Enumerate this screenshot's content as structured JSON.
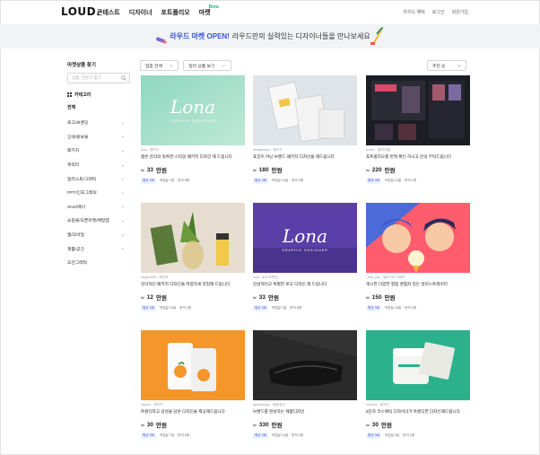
{
  "header": {
    "logo": "LOUD.",
    "nav": [
      {
        "label": "콘테스트"
      },
      {
        "label": "디자이너"
      },
      {
        "label": "포트폴리오"
      },
      {
        "label": "마켓",
        "badge": "Beta"
      }
    ],
    "util": [
      "라우드 혜택",
      "로그인",
      "회원가입"
    ]
  },
  "banner": {
    "highlight": "라우드 마켓 OPEN!",
    "text": "라우드만의 실력있는 디자이너들을 만나보세요"
  },
  "sidebar": {
    "title": "마켓상품 찾기",
    "search_placeholder": "상품, 전문가 찾기",
    "category_label": "카테고리",
    "all_label": "전체",
    "items": [
      {
        "label": "로고/브랜딩",
        "chevron": true
      },
      {
        "label": "인쇄/홍보물",
        "chevron": true
      },
      {
        "label": "패키지",
        "chevron": true
      },
      {
        "label": "캐릭터",
        "chevron": true
      },
      {
        "label": "일러스트/그래픽",
        "chevron": true
      },
      {
        "label": "PPT/인포그래픽",
        "chevron": true
      },
      {
        "label": "SNS/배너",
        "chevron": true
      },
      {
        "label": "쇼핑몰/오픈마켓/배달앱",
        "chevron": true
      },
      {
        "label": "웹/모바일",
        "chevron": true
      },
      {
        "label": "제품/공간",
        "chevron": true
      },
      {
        "label": "모션그래픽",
        "chevron": false
      }
    ]
  },
  "filters": {
    "category_select": "업종 전체",
    "type_select": "일러 상품 보기",
    "sort_select": "추천 순"
  },
  "cards": [
    {
      "meta": "lona · 패키지",
      "title": "젊은 감각의 독특한 스타일 패키지 디자인 해 드립니다",
      "price": "33",
      "unit": "만원",
      "tag1": "평균 3회",
      "tag2": "작업일 7일",
      "tag3": "문의 8명"
    },
    {
      "meta": "designstand · 패키지",
      "title": "포장이 아닌 브랜드 패키지 디자인을 해드립니다",
      "price": "180",
      "unit": "만원",
      "tag1": "평균 3회",
      "tag2": "작업일 14일",
      "tag3": "문의 3명"
    },
    {
      "meta": "kohee · 웹/모바일",
      "title": "포트폴리오를 반짝 확인 하시고 문의 부탁드립니다",
      "price": "220",
      "unit": "만원",
      "tag1": "평균 4회",
      "tag2": "작업일 14일",
      "tag3": "문의 1명"
    },
    {
      "meta": "seyjin0406 · 패키지",
      "title": "감각적인 패키지 디자인을 저렴하게 작업해 드립니다",
      "price": "12",
      "unit": "만원",
      "tag1": "평균 2회",
      "tag2": "작업일 10일",
      "tag3": "문의 0명"
    },
    {
      "meta": "lona · 로고/브랜딩",
      "title": "감성적이고 특별한 로고 디자인 해 드립니다",
      "price": "33",
      "unit": "만원",
      "tag1": "평균 3회",
      "tag2": "작업일 7일",
      "tag3": "문의 8명"
    },
    {
      "meta": "_ddo_yun · 일러스트/그래픽",
      "title": "섹시한 다양한 협업 경험자 있는 일러스트레이터",
      "price": "150",
      "unit": "만원",
      "tag1": "평균 3회",
      "tag2": "작업일 15일",
      "tag3": "문의 2명"
    },
    {
      "meta": "lleeceu · 패키지",
      "title": "트렌디하고 감성을 담은 디자인을 제공해드립니다",
      "price": "30",
      "unit": "만원",
      "tag1": "평균 3회",
      "tag2": "작업일 7일",
      "tag3": "문의 8명"
    },
    {
      "meta": "ammdesign · 제품/공간",
      "title": "브랜드를 완성하는 제품디자인",
      "price": "330",
      "unit": "만원",
      "tag1": "평균 3회",
      "tag2": "작업일 14일",
      "tag3": "문의 4명"
    },
    {
      "meta": "cosmeo · 패키지",
      "title": "5단차 코스메틱 디자이너가 트렌디한 디자인해드립니다",
      "price": "30",
      "unit": "만원",
      "tag1": "평균 3회",
      "tag2": "작업일 2일",
      "tag3": "문의 0명"
    }
  ],
  "thumbs": [
    {
      "name": "lona-package-thumb",
      "text": "Lona",
      "sub": "GRAPHIC DESIGNER",
      "bg1": "#8fd8c0",
      "bg2": "#bfe8d8"
    },
    {
      "name": "pouch-package-thumb",
      "bg1": "#dfe4e8"
    },
    {
      "name": "web-portfolio-thumb",
      "bg1": "#1c1c24"
    },
    {
      "name": "bottle-package-thumb",
      "bg1": "#e6ddd0"
    },
    {
      "name": "lona-logo-thumb",
      "text": "Lona",
      "sub": "GRAPHIC DESIGNER",
      "bg1": "#5a3fa8"
    },
    {
      "name": "illustration-thumb",
      "bg1": "#ff5d6e"
    },
    {
      "name": "orange-pouch-thumb",
      "bg1": "#f4962a"
    },
    {
      "name": "product-device-thumb",
      "bg1": "#2a2a2a"
    },
    {
      "name": "cosmetic-jar-thumb",
      "bg1": "#2bb28c"
    }
  ]
}
